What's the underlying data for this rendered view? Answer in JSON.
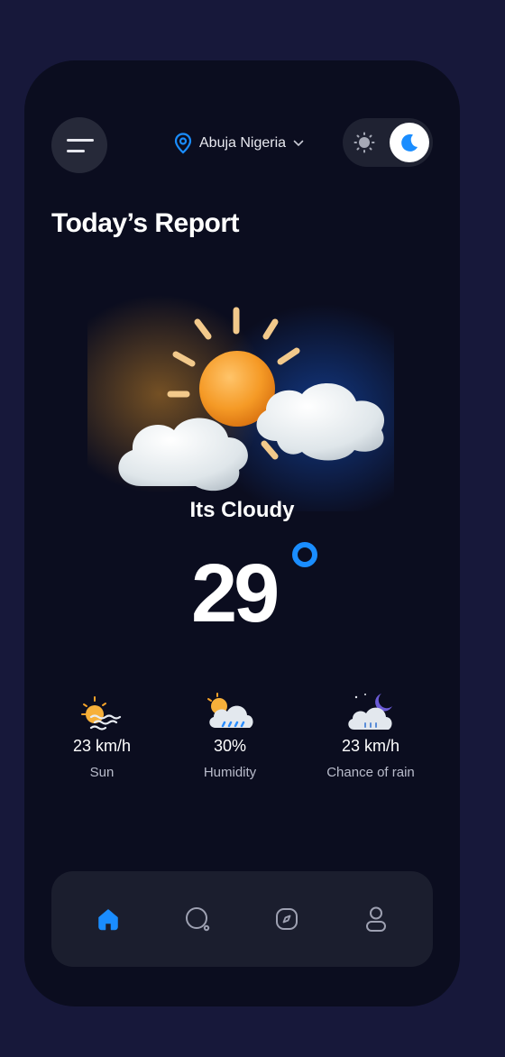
{
  "header": {
    "location": "Abuja Nigeria",
    "theme_mode": "dark"
  },
  "report": {
    "title": "Today’s Report",
    "condition": "Its Cloudy",
    "temperature": "29"
  },
  "stats": [
    {
      "value": "23 km/h",
      "label": "Sun",
      "icon": "sun-wind-icon"
    },
    {
      "value": "30%",
      "label": "Humidity",
      "icon": "sun-rain-cloud-icon"
    },
    {
      "value": "23 km/h",
      "label": "Chance of rain",
      "icon": "moon-rain-cloud-icon"
    }
  ],
  "nav": {
    "items": [
      "home-icon",
      "search-icon",
      "compass-icon",
      "profile-icon"
    ],
    "active": "home"
  },
  "colors": {
    "background": "#17183a",
    "card": "#0b0d1f",
    "accent": "#1a8dff",
    "sun": "#f5a22a"
  }
}
